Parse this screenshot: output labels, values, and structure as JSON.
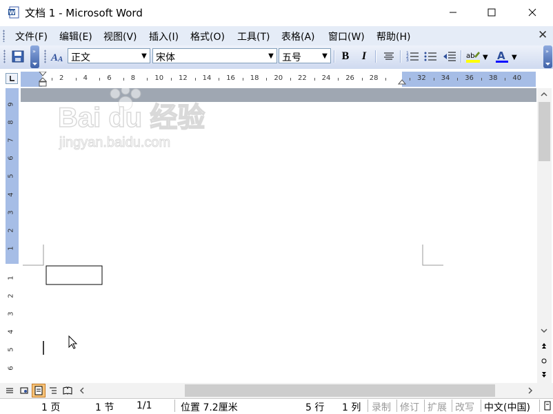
{
  "window": {
    "title": "文档 1 - Microsoft Word",
    "controls": {
      "minimize": "—",
      "maximize": "☐",
      "close": "✕"
    }
  },
  "menubar": {
    "items": [
      "文件(F)",
      "编辑(E)",
      "视图(V)",
      "插入(I)",
      "格式(O)",
      "工具(T)",
      "表格(A)",
      "窗口(W)",
      "帮助(H)"
    ],
    "close_glyph": "✕"
  },
  "toolbar": {
    "style": "正文",
    "font": "宋体",
    "size": "五号",
    "bold": "B",
    "italic": "I",
    "font_color_glyph": "A",
    "highlight_color": "#ffff00",
    "font_color": "#0000ff"
  },
  "ruler": {
    "h_ticks": [
      "2",
      "4",
      "6",
      "8",
      "10",
      "12",
      "14",
      "16",
      "18",
      "20",
      "22",
      "24",
      "26",
      "28",
      "",
      "32",
      "34",
      "36",
      "38",
      "40"
    ],
    "v_ticks_top": [
      "9",
      "8",
      "7",
      "6",
      "5",
      "4",
      "3",
      "2",
      "1"
    ],
    "v_ticks_bottom": [
      "1",
      "2",
      "3",
      "4",
      "5",
      "6"
    ]
  },
  "watermark": {
    "brand": "Bai du 经验",
    "url": "jingyan.baidu.com"
  },
  "statusbar": {
    "page": "1 页",
    "section": "1 节",
    "page_of": "1/1",
    "position": "位置 7.2厘米",
    "line": "5 行",
    "column": "1 列",
    "rec": "录制",
    "trk": "修订",
    "ext": "扩展",
    "ovr": "改写",
    "language": "中文(中国)"
  },
  "colors": {
    "menubar_bg": "#e5ecf7",
    "ruler_margin": "#a6bde6",
    "page_band": "#9fa7b2",
    "toolbar_accent": "#3f62a9"
  }
}
